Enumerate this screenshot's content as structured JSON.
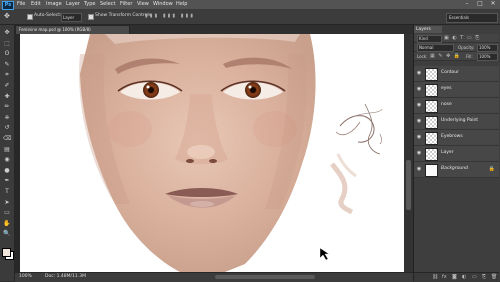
{
  "app": {
    "logo": "Ps"
  },
  "menu": [
    "File",
    "Edit",
    "Image",
    "Layer",
    "Type",
    "Select",
    "Filter",
    "View",
    "Window",
    "Help"
  ],
  "window_controls": [
    "–",
    "□",
    "✕"
  ],
  "options": {
    "auto_select_label": "Auto-Select:",
    "layer_value": "Layer",
    "show_transform_label": "Show Transform Controls",
    "workspace": "Essentials"
  },
  "document": {
    "tab_title": "Feminine map.psd @ 100% (RGB/8)",
    "zoom": "100%",
    "doc_size": "Doc: 1.48M/11.3M"
  },
  "layers_panel": {
    "tab_label": "Layers",
    "kind_label": "Kind",
    "blend_mode": "Normal",
    "opacity": "100%",
    "lock_label": "Lock:",
    "fill": "100%",
    "layers": [
      {
        "name": "Contour",
        "selected": false
      },
      {
        "name": "eyes",
        "selected": false
      },
      {
        "name": "nose",
        "selected": false
      },
      {
        "name": "Underlying Paint",
        "selected": false
      },
      {
        "name": "Eyebrows",
        "selected": false
      },
      {
        "name": "Layer",
        "selected": false
      },
      {
        "name": "Background",
        "selected": false,
        "locked": true
      }
    ]
  },
  "tools": [
    "move-icon",
    "marquee-icon",
    "lasso-icon",
    "quick-select-icon",
    "crop-icon",
    "eyedropper-icon",
    "healing-icon",
    "brush-icon",
    "stamp-icon",
    "history-brush-icon",
    "eraser-icon",
    "gradient-icon",
    "blur-icon",
    "dodge-icon",
    "pen-icon",
    "type-icon",
    "path-select-icon",
    "shape-icon",
    "hand-icon",
    "zoom-icon"
  ],
  "tool_glyphs": [
    "✥",
    "⬚",
    "ʘ",
    "✎",
    "⌗",
    "✐",
    "✚",
    "✏",
    "⎈",
    "↺",
    "⌫",
    "▤",
    "◉",
    "●",
    "✒",
    "T",
    "➤",
    "▭",
    "✋",
    "🔍"
  ],
  "colors": {
    "foreground": "#f0e6dc",
    "background": "#ffffff"
  }
}
